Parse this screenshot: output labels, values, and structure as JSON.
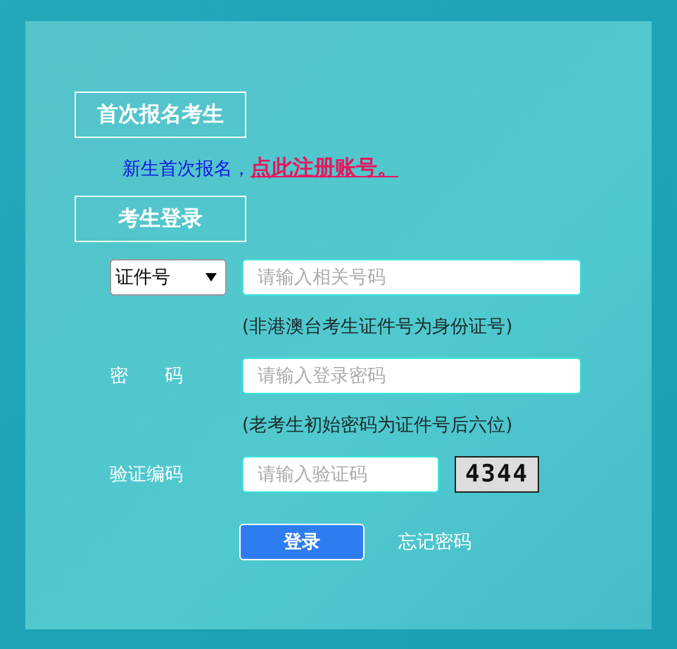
{
  "sections": [
    {
      "title": "首次报名考生"
    },
    {
      "title": "考生登录"
    }
  ],
  "register": {
    "text": "新生首次报名，",
    "link": "点此注册账号。"
  },
  "login": {
    "id_type": "证件号",
    "id_placeholder": "请输入相关号码",
    "id_hint": "(非港澳台考生证件号为身份证号)",
    "password_label": "密　　码",
    "password_placeholder": "请输入登录密码",
    "password_hint": "(老考生初始密码为证件号后六位)",
    "captcha_label": "验证编码",
    "captcha_placeholder": "请输入验证码",
    "captcha_code": "4344",
    "submit": "登录",
    "forgot": "忘记密码"
  }
}
